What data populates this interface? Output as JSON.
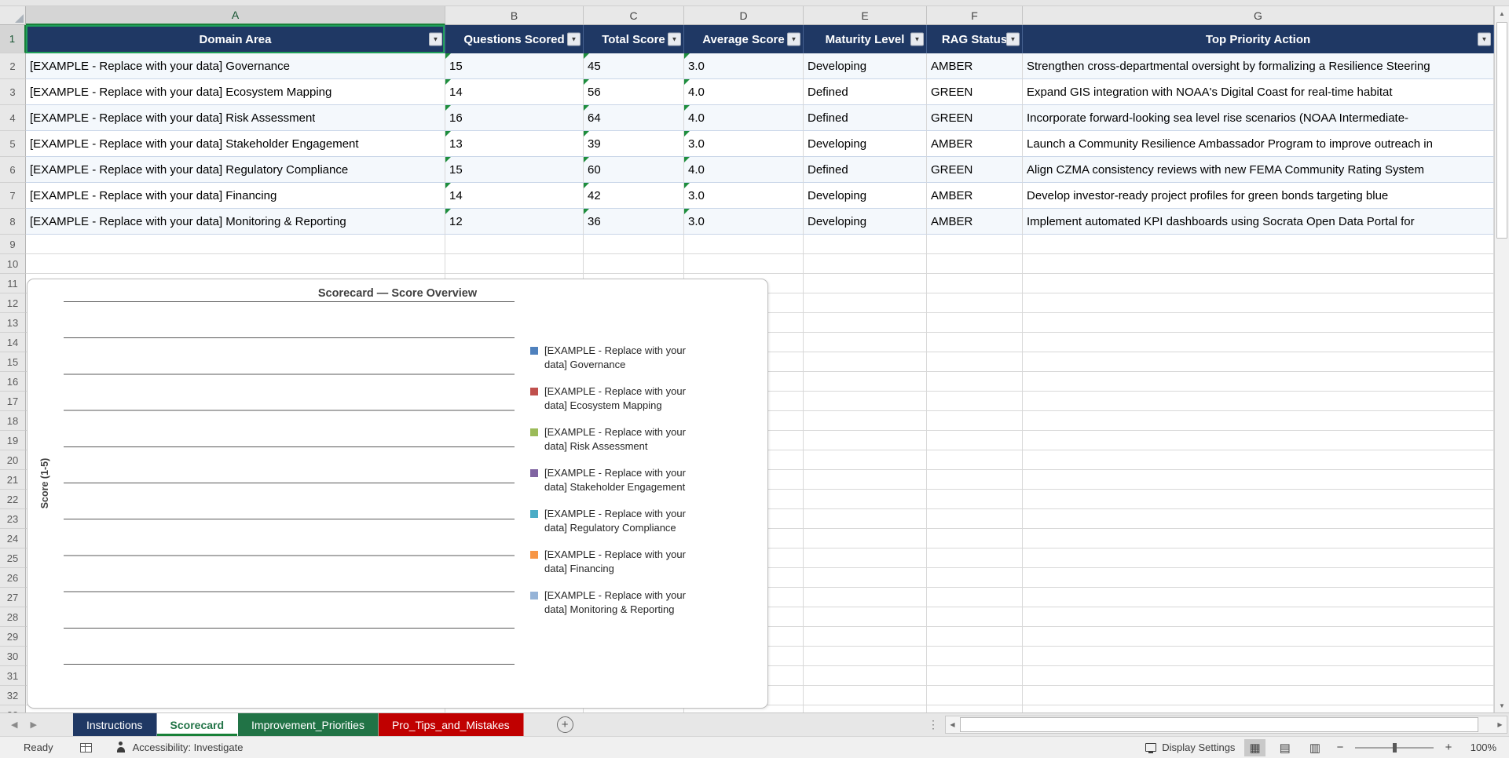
{
  "grid": {
    "columns": [
      {
        "letter": "A"
      },
      {
        "letter": "B"
      },
      {
        "letter": "C"
      },
      {
        "letter": "D"
      },
      {
        "letter": "E"
      },
      {
        "letter": "F"
      },
      {
        "letter": "G"
      }
    ],
    "selected_column": "A",
    "selected_row": 1,
    "first_visible_row": 1,
    "last_visible_row": 32
  },
  "table": {
    "headers": [
      {
        "label": "Domain Area"
      },
      {
        "label": "Questions Scored"
      },
      {
        "label": "Total Score"
      },
      {
        "label": "Average Score"
      },
      {
        "label": "Maturity Level"
      },
      {
        "label": "RAG Status"
      },
      {
        "label": "Top Priority Action"
      }
    ],
    "error_indicator_columns": [
      "B",
      "C",
      "D"
    ],
    "rows": [
      [
        "[EXAMPLE - Replace with your data] Governance",
        "15",
        "45",
        "3.0",
        "Developing",
        "AMBER",
        "Strengthen cross-departmental oversight by formalizing a Resilience Steering"
      ],
      [
        "[EXAMPLE - Replace with your data] Ecosystem Mapping",
        "14",
        "56",
        "4.0",
        "Defined",
        "GREEN",
        "Expand GIS integration with NOAA's Digital Coast for real-time habitat"
      ],
      [
        "[EXAMPLE - Replace with your data] Risk Assessment",
        "16",
        "64",
        "4.0",
        "Defined",
        "GREEN",
        "Incorporate forward-looking sea level rise scenarios (NOAA Intermediate-"
      ],
      [
        "[EXAMPLE - Replace with your data] Stakeholder Engagement",
        "13",
        "39",
        "3.0",
        "Developing",
        "AMBER",
        "Launch a Community Resilience Ambassador Program to improve outreach in"
      ],
      [
        "[EXAMPLE - Replace with your data] Regulatory Compliance",
        "15",
        "60",
        "4.0",
        "Defined",
        "GREEN",
        "Align CZMA consistency reviews with new FEMA Community Rating System"
      ],
      [
        "[EXAMPLE - Replace with your data] Financing",
        "14",
        "42",
        "3.0",
        "Developing",
        "AMBER",
        "Develop investor-ready project profiles for green bonds targeting blue"
      ],
      [
        "[EXAMPLE - Replace with your data] Monitoring & Reporting",
        "12",
        "36",
        "3.0",
        "Developing",
        "AMBER",
        "Implement automated KPI dashboards using Socrata Open Data Portal for"
      ]
    ]
  },
  "chart_data": {
    "type": "bar",
    "title": "Scorecard — Score Overview",
    "xlabel": "",
    "ylabel": "Score (1-5)",
    "legend_position": "right",
    "gridlines": true,
    "plot_rendered_empty": true,
    "series": [
      {
        "name": "[EXAMPLE - Replace with your data] Governance",
        "color": "#4F81BD",
        "values": []
      },
      {
        "name": "[EXAMPLE - Replace with your data] Ecosystem Mapping",
        "color": "#C0504D",
        "values": []
      },
      {
        "name": "[EXAMPLE - Replace with your data] Risk Assessment",
        "color": "#9BBB59",
        "values": []
      },
      {
        "name": "[EXAMPLE - Replace with your data] Stakeholder Engagement",
        "color": "#8064A2",
        "values": []
      },
      {
        "name": "[EXAMPLE - Replace with your data] Regulatory Compliance",
        "color": "#4BACC6",
        "values": []
      },
      {
        "name": "[EXAMPLE - Replace with your data] Financing",
        "color": "#F79646",
        "values": []
      },
      {
        "name": "[EXAMPLE - Replace with your data] Monitoring & Reporting",
        "color": "#95B3D7",
        "values": []
      }
    ]
  },
  "sheet_tabs": {
    "add_label": "+",
    "tabs": [
      {
        "label": "Instructions",
        "active": false,
        "bg": "#1F3864",
        "text": "#FFFFFF"
      },
      {
        "label": "Scorecard",
        "active": true,
        "bg": "#FFFFFF",
        "text": "#217346"
      },
      {
        "label": "Improvement_Priorities",
        "active": false,
        "bg": "#217346",
        "text": "#FFFFFF"
      },
      {
        "label": "Pro_Tips_and_Mistakes",
        "active": false,
        "bg": "#C00000",
        "text": "#FFFFFF"
      }
    ]
  },
  "status_bar": {
    "ready": "Ready",
    "accessibility": "Accessibility: Investigate",
    "display_settings": "Display Settings",
    "zoom_out": "−",
    "zoom_in": "+",
    "zoom": "100%"
  }
}
